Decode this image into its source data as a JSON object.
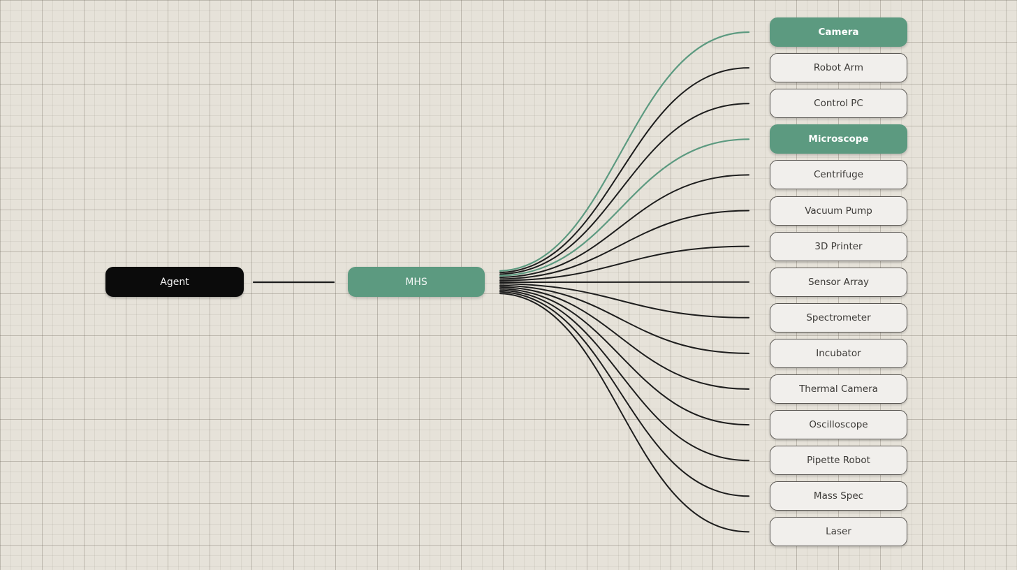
{
  "diagram": {
    "source": {
      "label": "Agent"
    },
    "hub": {
      "label": "MHS"
    },
    "devices": [
      {
        "label": "Camera",
        "highlighted": true
      },
      {
        "label": "Robot Arm",
        "highlighted": false
      },
      {
        "label": "Control PC",
        "highlighted": false
      },
      {
        "label": "Microscope",
        "highlighted": true
      },
      {
        "label": "Centrifuge",
        "highlighted": false
      },
      {
        "label": "Vacuum Pump",
        "highlighted": false
      },
      {
        "label": "3D Printer",
        "highlighted": false
      },
      {
        "label": "Sensor Array",
        "highlighted": false
      },
      {
        "label": "Spectrometer",
        "highlighted": false
      },
      {
        "label": "Incubator",
        "highlighted": false
      },
      {
        "label": "Thermal Camera",
        "highlighted": false
      },
      {
        "label": "Oscilloscope",
        "highlighted": false
      },
      {
        "label": "Pipette Robot",
        "highlighted": false
      },
      {
        "label": "Mass Spec",
        "highlighted": false
      },
      {
        "label": "Laser",
        "highlighted": false
      }
    ]
  },
  "colors": {
    "accent": "#5c9a80",
    "line": "#1d1d1d",
    "source_fill": "#0b0b0b",
    "device_fill": "#f1efec",
    "background": "#e6e2d9"
  }
}
